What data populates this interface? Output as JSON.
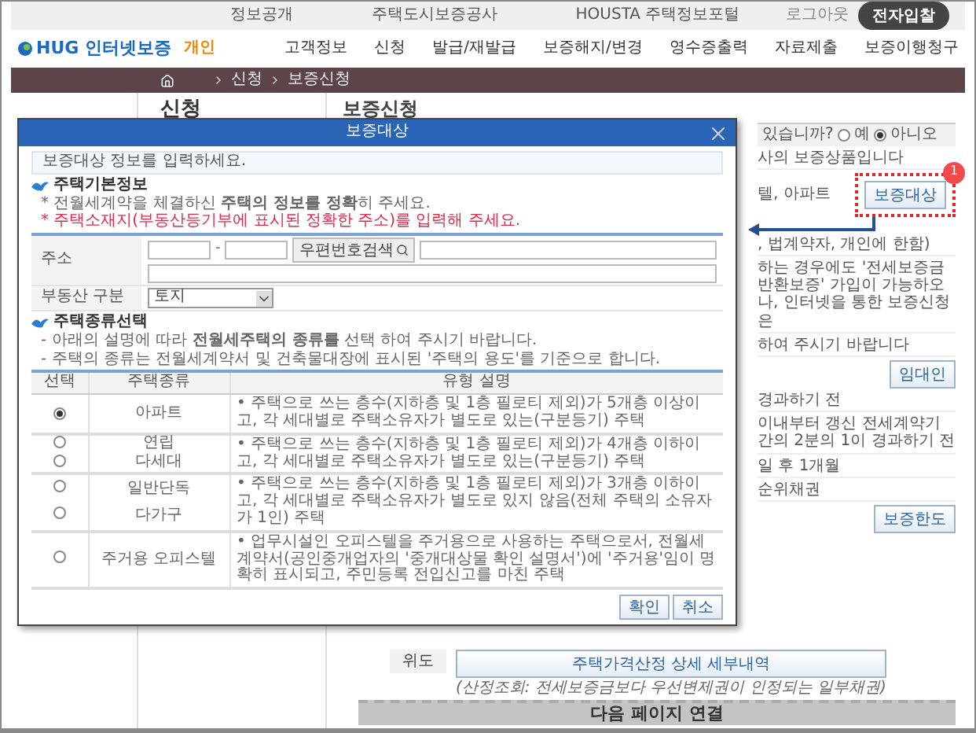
{
  "top_bar": {
    "links": [
      "정보공개",
      "주택도시보증공사",
      "HOUSTA 주택정보포털"
    ],
    "logout": "로그아웃",
    "bid_button": "전자입찰"
  },
  "header": {
    "logo": "HUG 인터넷보증",
    "logo_tag": "개인",
    "menu": [
      "고객정보",
      "신청",
      "발급/재발급",
      "보증해지/변경",
      "영수증출력",
      "자료제출",
      "보증이행청구"
    ]
  },
  "breadcrumb": [
    "신청",
    "보증신청"
  ],
  "sidebar": {
    "title": "신청"
  },
  "page": {
    "title": "보증신청",
    "fragments": [
      {
        "kind": "question",
        "text": "있습니까?",
        "options": [
          {
            "label": "예",
            "selected": false
          },
          {
            "label": "아니오",
            "selected": true
          }
        ]
      },
      {
        "kind": "text",
        "text": "사의 보증상품입니다"
      },
      {
        "kind": "callout",
        "text": "텔, 아파트",
        "button": "보증대상",
        "badge": "1"
      },
      {
        "kind": "text",
        "text": ", 법계약자, 개인에 한함)"
      },
      {
        "kind": "text",
        "text": "하는 경우에도 '전세보증금반환보증' 가입이 가능하오나, 인터넷을 통한 보증신청은"
      },
      {
        "kind": "text",
        "text": "하여 주시기 바랍니다"
      },
      {
        "kind": "button",
        "button": "임대인"
      },
      {
        "kind": "text",
        "text": "경과하기 전"
      },
      {
        "kind": "text",
        "text": "이내부터 갱신 전세계약기간의 2분의 1이 경과하기 전"
      },
      {
        "kind": "text",
        "text": "일 후 1개월"
      },
      {
        "kind": "text",
        "text": "순위채권"
      },
      {
        "kind": "button",
        "button": "보증한도"
      }
    ],
    "bottom": {
      "label": "위도",
      "button": "주택가격산정 상세 세부내역",
      "note": "(산정조회: 전세보증금보다 우선변제권이 인정되는 일부채권)"
    },
    "next_link": "다음 페이지 연결"
  },
  "dialog": {
    "title": "보증대상",
    "info": "보증대상 정보를 입력하세요.",
    "basic": {
      "heading": "주택기본정보",
      "notes": [
        {
          "kind": "normal",
          "text": "* 전월세계약을 체결하신 **주택의 정보를 정확**히 주세요."
        },
        {
          "kind": "warning",
          "text": "* 주택소재지(부동산등기부에 표시된 정확한 주소)를 입력해 주세요."
        }
      ],
      "address_label": "주소",
      "zip_separator": "-",
      "zip_button": "우편번호검색",
      "type_label": "부동산 구분",
      "type_value": "토지"
    },
    "types": {
      "heading": "주택종류선택",
      "notes": [
        {
          "kind": "normal",
          "text": "- 아래의 설명에 따라 **전월세주택의 종류를** 선택 하여 주시기 바랍니다."
        },
        {
          "kind": "normal",
          "text": "- 주택의 종류는 전월세계약서 및 건축물대장에 표시된 '주택의 용도'를 기준으로 합니다."
        }
      ],
      "columns": [
        "선택",
        "주택종류",
        "유형 설명"
      ],
      "groups": [
        {
          "types": [
            {
              "label": "아파트",
              "selected": true
            }
          ],
          "description": "• 주택으로 쓰는 층수(지하층 및 1층 필로티 제외)가 5개층 이상이고, 각 세대별로 주택소유자가 별도로 있는(구분등기) 주택"
        },
        {
          "types": [
            {
              "label": "연립",
              "selected": false
            },
            {
              "label": "다세대",
              "selected": false
            }
          ],
          "description": "• 주택으로 쓰는 층수(지하층 및 1층 필로티 제외)가 4개층 이하이고, 각 세대별로 주택소유자가 별도로 있는(구분등기) 주택"
        },
        {
          "types": [
            {
              "label": "일반단독",
              "selected": false
            },
            {
              "label": "다가구",
              "selected": false
            }
          ],
          "description": "• 주택으로 쓰는 층수(지하층 및 1층 필로티 제외)가 3개층 이하이고, 각 세대별로 주택소유자가 별도로 있지 않음(전체 주택의 소유자가 1인) 주택"
        },
        {
          "types": [
            {
              "label": "주거용 오피스텔",
              "selected": false
            }
          ],
          "description": "• 업무시설인 오피스텔을 주거용으로 사용하는 주택으로서, 전월세계약서(공인중개업자의 '중개대상물 확인 설명서')에 '주거용'임이 명확히 표시되고, 주민등록 전입신고를 마친 주택"
        }
      ]
    },
    "buttons": [
      "확인",
      "취소"
    ]
  }
}
